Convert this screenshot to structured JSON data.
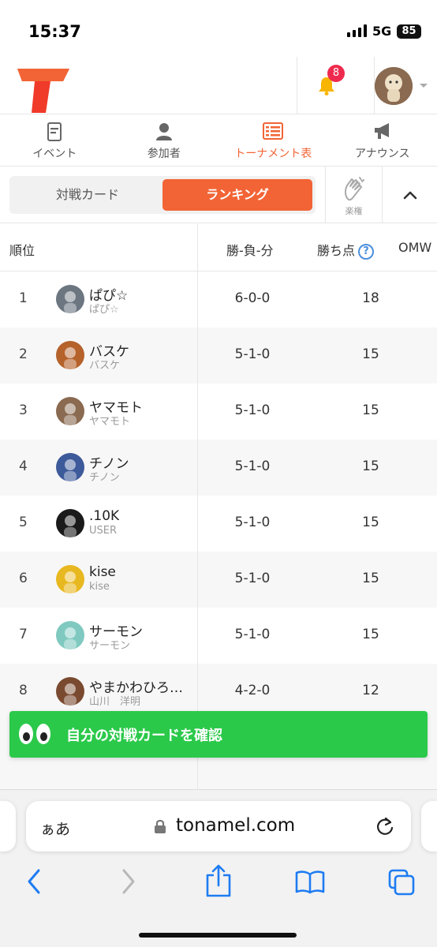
{
  "status_bar": {
    "time": "15:37",
    "network": "5G",
    "battery": "85"
  },
  "header": {
    "notification_count": "8"
  },
  "nav": [
    {
      "label": "イベント",
      "icon": "document-icon"
    },
    {
      "label": "参加者",
      "icon": "person-icon"
    },
    {
      "label": "トーナメント表",
      "icon": "bracket-list-icon"
    },
    {
      "label": "アナウンス",
      "icon": "megaphone-icon"
    }
  ],
  "segment": {
    "tab_cards": "対戦カード",
    "tab_ranking": "ランキング",
    "clap_label": "楽権"
  },
  "table": {
    "headers": {
      "rank": "順位",
      "record": "勝-負-分",
      "points": "勝ち点",
      "help": "?",
      "omw": "OMW"
    },
    "rows": [
      {
        "rank": "1",
        "name": "ぱぴ☆",
        "sub": "ぱぴ☆",
        "record": "6-0-0",
        "points": "18",
        "avatar_color": "#6b7680"
      },
      {
        "rank": "2",
        "name": "バスケ",
        "sub": "バスケ",
        "record": "5-1-0",
        "points": "15",
        "avatar_color": "#b5622b"
      },
      {
        "rank": "3",
        "name": "ヤマモト",
        "sub": "ヤマモト",
        "record": "5-1-0",
        "points": "15",
        "avatar_color": "#8a6a50"
      },
      {
        "rank": "4",
        "name": "チノン",
        "sub": "チノン",
        "record": "5-1-0",
        "points": "15",
        "avatar_color": "#3d5a9a"
      },
      {
        "rank": "5",
        "name": ".10K",
        "sub": "USER",
        "record": "5-1-0",
        "points": "15",
        "avatar_color": "#1a1a1a"
      },
      {
        "rank": "6",
        "name": "kise",
        "sub": "kise",
        "record": "5-1-0",
        "points": "15",
        "avatar_color": "#e8b820"
      },
      {
        "rank": "7",
        "name": "サーモン",
        "sub": "サーモン",
        "record": "5-1-0",
        "points": "15",
        "avatar_color": "#7fc9c0"
      },
      {
        "rank": "8",
        "name": "やまかわひろ…",
        "sub": "山川　洋明",
        "record": "4-2-0",
        "points": "12",
        "avatar_color": "#7a4a30"
      }
    ]
  },
  "cta": {
    "label": "自分の対戦カードを確認"
  },
  "browser": {
    "aa": "ぁあ",
    "url": "tonamel.com"
  },
  "colors": {
    "accent": "#f26436",
    "cta": "#2bc94a",
    "badge": "#ee2b4e",
    "link": "#1e7cf2"
  }
}
